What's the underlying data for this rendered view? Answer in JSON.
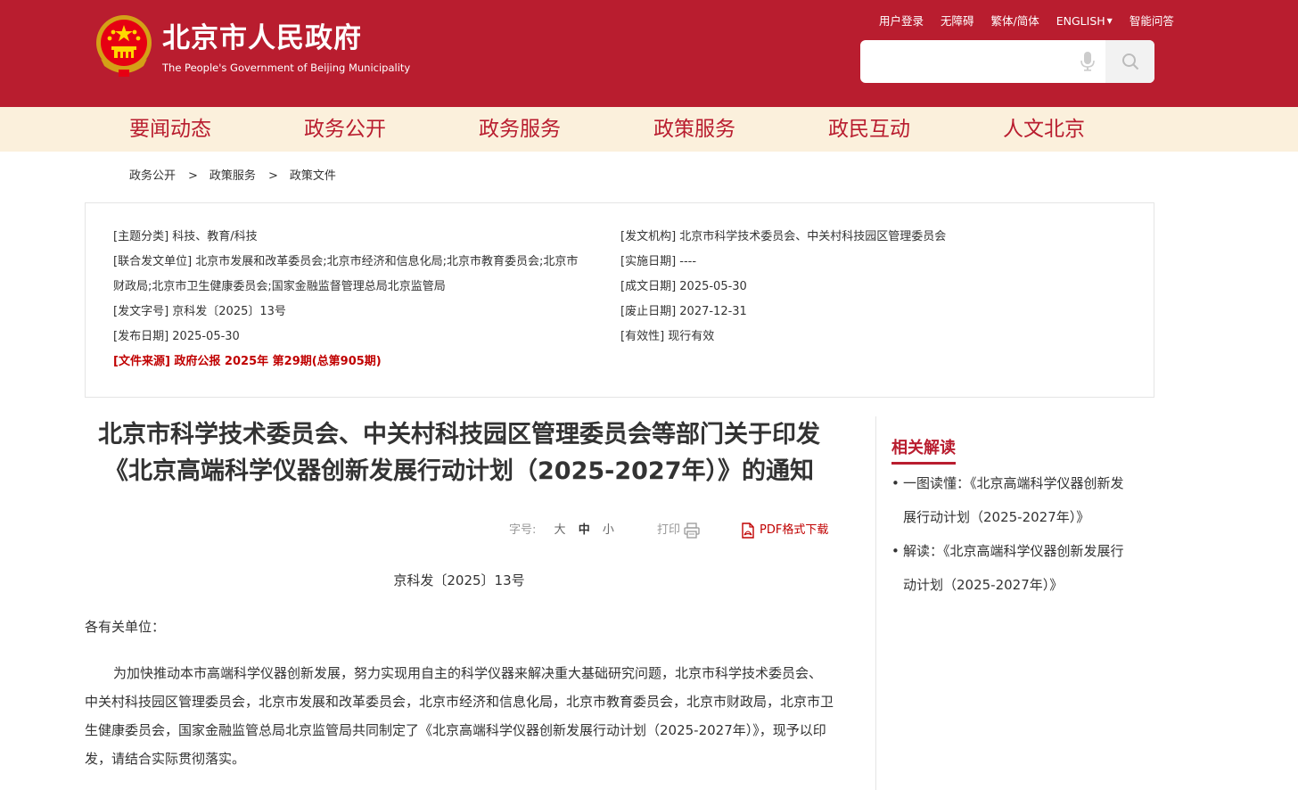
{
  "header": {
    "title": "北京市人民政府",
    "subtitle": "The People's Government of Beijing Municipality",
    "links": [
      "用户登录",
      "无障碍",
      "繁体/简体",
      "ENGLISH",
      "智能问答"
    ],
    "search_placeholder": "",
    "bg_color": "#b91d2f"
  },
  "nav": {
    "items": [
      "要闻动态",
      "政务公开",
      "政务服务",
      "政策服务",
      "政民互动",
      "人文北京"
    ],
    "bg_color": "#fbf0dc"
  },
  "breadcrumb": {
    "items": [
      "政务公开",
      "政策服务",
      "政策文件"
    ],
    "separator": ">"
  },
  "meta": {
    "subject": "[主题分类] 科技、教育/科技",
    "joint_l1": "[联合发文单位] 北京市发展和改革委员会;北京市经济和信息化局;北京市教育委员会;北京市",
    "joint_l2": "财政局;北京市卫生健康委员会;国家金融监督管理总局北京监管局",
    "docno": "[发文字号] 京科发〔2025〕13号",
    "pubdate": "[发布日期] 2025-05-30",
    "source": "[文件来源] 政府公报 2025年 第29期(总第905期)",
    "issuer": "[发文机构] 北京市科学技术委员会、中关村科技园区管理委员会",
    "impl_date": "[实施日期] ----",
    "written_date": "[成文日期] 2025-05-30",
    "expiry_date": "[废止日期] 2027-12-31",
    "validity": "[有效性] 现行有效"
  },
  "article": {
    "title_line1": "北京市科学技术委员会、中关村科技园区管理委员会等部门关于印发",
    "title_line2": "《北京高端科学仪器创新发展行动计划（2025-2027年）》的通知",
    "font_label": "字号:",
    "font_sizes": [
      "大",
      "中",
      "小"
    ],
    "print_label": "打印",
    "pdf_label": "PDF格式下载",
    "doc_number": "京科发〔2025〕13号",
    "salutation": "各有关单位：",
    "paragraph": "为加快推动本市高端科学仪器创新发展，努力实现用自主的科学仪器来解决重大基础研究问题，北京市科学技术委员会、中关村科技园区管理委员会，北京市发展和改革委员会，北京市经济和信息化局，北京市教育委员会，北京市财政局，北京市卫生健康委员会，国家金融监管总局北京监管局共同制定了《北京高端科学仪器创新发展行动计划（2025-2027年）》，现予以印发，请结合实际贯彻落实。"
  },
  "sidebar": {
    "heading": "相关解读",
    "bullet": "•",
    "items": [
      {
        "l1": "一图读懂：《北京高端科学仪器创新发",
        "l2": "展行动计划（2025-2027年）》"
      },
      {
        "l1": "解读：《北京高端科学仪器创新发展行",
        "l2": "动计划（2025-2027年）》"
      }
    ],
    "accent_color": "#b91d2f"
  }
}
